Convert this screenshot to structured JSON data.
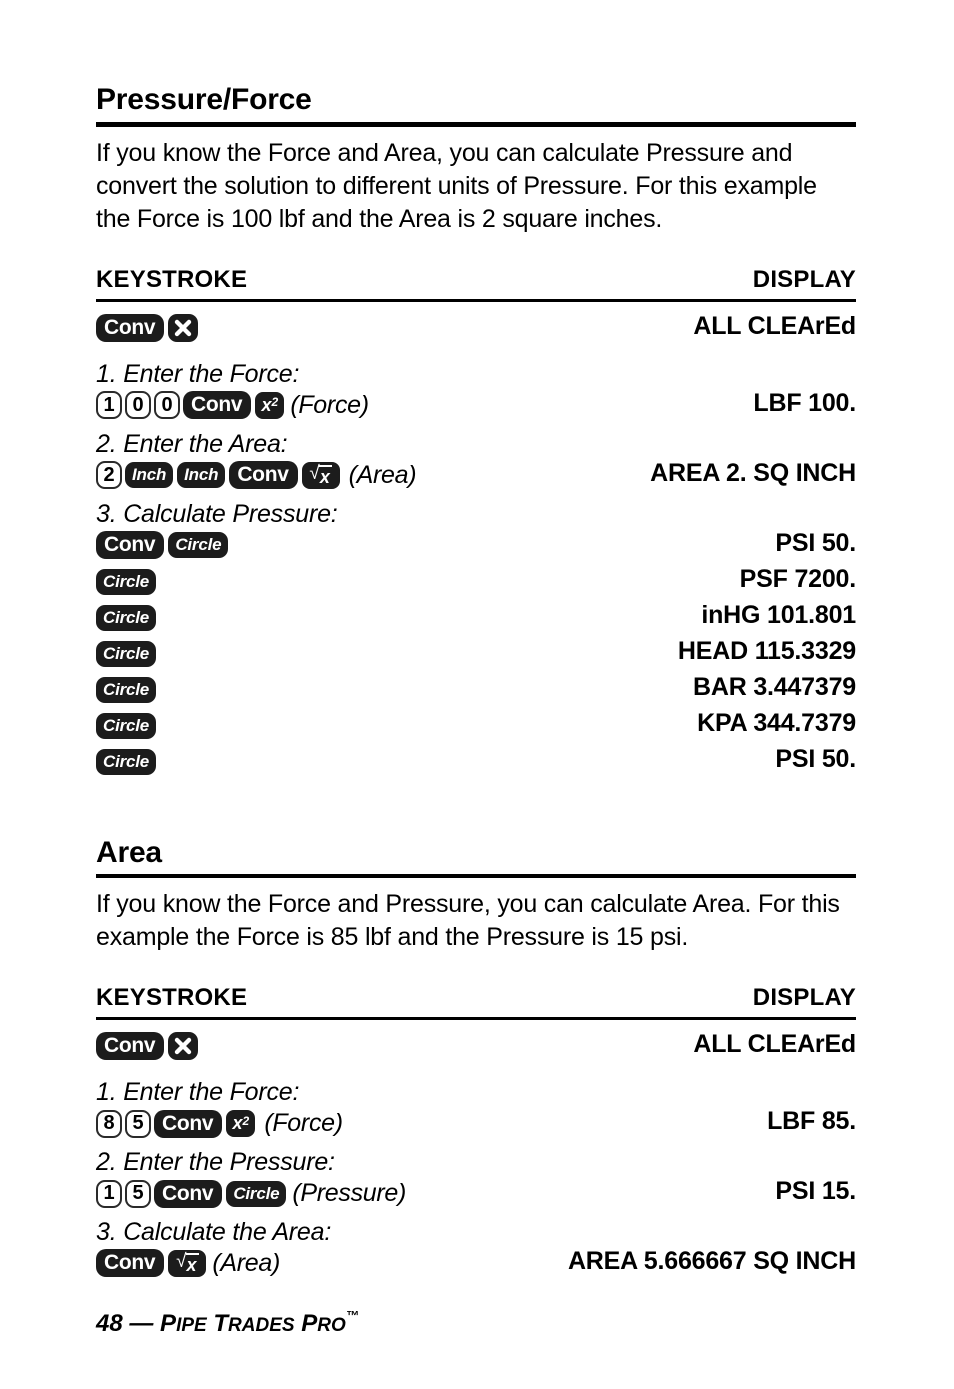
{
  "document": {
    "footer": {
      "page_number": "48",
      "dash": "—",
      "brand_p1": "P",
      "brand_rest1": "IPE",
      "brand_p2": "T",
      "brand_rest2": "RADES",
      "brand_p3": "P",
      "brand_rest3": "RO",
      "trademark": "™"
    }
  },
  "sections": [
    {
      "title": "Pressure/Force",
      "intro": "If you know the Force and Area, you can calculate Pressure and convert the solution to different units of Pressure. For this example the Force is 100 lbf and the Area is 2 square inches.",
      "columns": {
        "keystroke": "KEYSTROKE",
        "display": "DISPLAY"
      },
      "clear_row": {
        "display": "ALL CLEArEd"
      },
      "steps": [
        {
          "label": "1. Enter the Force:",
          "annotation": "(Force)",
          "display": "LBF  100."
        },
        {
          "label": "2. Enter the Area:",
          "annotation": "(Area)",
          "display": "AREA  2. SQ INCH"
        },
        {
          "label": "3. Calculate Pressure:",
          "annotation": "",
          "display": "PSI 50."
        }
      ],
      "conversions": [
        {
          "key": "Circle",
          "display": "PSF 7200."
        },
        {
          "key": "Circle",
          "display": "inHG 101.801"
        },
        {
          "key": "Circle",
          "display": "HEAD 115.3329"
        },
        {
          "key": "Circle",
          "display": "BAR 3.447379"
        },
        {
          "key": "Circle",
          "display": "KPA 344.7379"
        },
        {
          "key": "Circle",
          "display": "PSI 50."
        }
      ]
    },
    {
      "title": "Area",
      "intro": "If you know the Force and Pressure, you can calculate Area. For this example the Force is 85 lbf and the Pressure is 15 psi.",
      "columns": {
        "keystroke": "KEYSTROKE",
        "display": "DISPLAY"
      },
      "clear_row": {
        "display": "ALL  CLEArEd"
      },
      "steps": [
        {
          "label": "1. Enter the Force:",
          "annotation": "(Force)",
          "display": "LBF 85."
        },
        {
          "label": "2. Enter the Pressure:",
          "annotation": "(Pressure)",
          "display": "PSI  15."
        },
        {
          "label": "3. Calculate the Area:",
          "annotation": "(Area)",
          "display": "AREA 5.666667 SQ INCH"
        }
      ]
    }
  ],
  "keys": {
    "conv": "Conv",
    "inch": "Inch",
    "circle": "Circle",
    "x2_base": "x",
    "x2_sup": "2",
    "sqrt_sym": "√",
    "sqrt_x": "x",
    "d1": "1",
    "d0": "0",
    "d2": "2",
    "d8": "8",
    "d5": "5"
  },
  "colors": {
    "key_dark": "#1c1c1c",
    "key_light": "#ffffff",
    "text": "#000000",
    "rule": "#000000"
  }
}
